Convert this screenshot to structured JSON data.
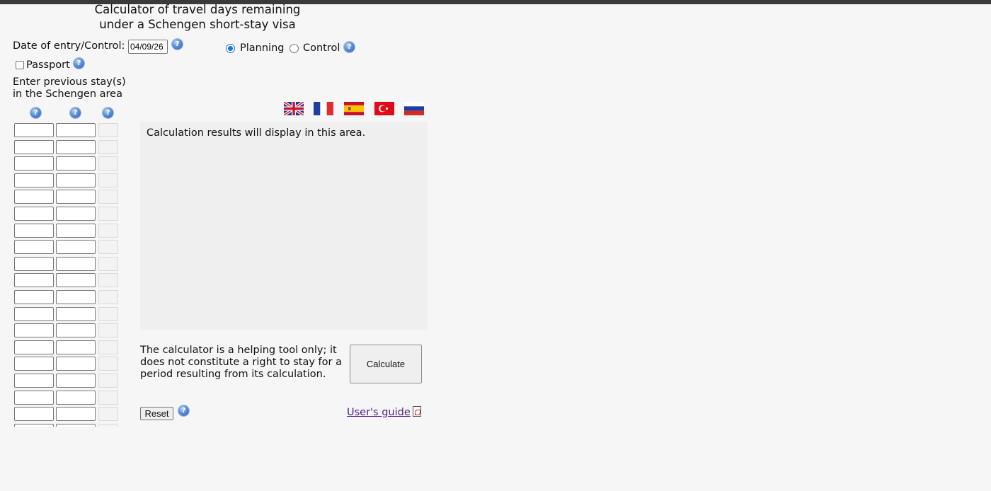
{
  "page": {
    "title_line1": "Calculator of travel days remaining",
    "title_line2": "under a Schengen short-stay visa",
    "help_symbol": "?"
  },
  "form": {
    "date_label": "Date of entry/Control:",
    "date_value": "04/09/26",
    "mode_planning": "Planning",
    "mode_control": "Control",
    "selected_mode": "Planning",
    "passport_label": "Passport",
    "passport_checked": false,
    "stays_line1": "Enter previous stay(s)",
    "stays_line2": "in the Schengen area",
    "stay_row_count": 19
  },
  "languages": [
    {
      "name": "uk-flag-icon"
    },
    {
      "name": "france-flag-icon"
    },
    {
      "name": "spain-flag-icon"
    },
    {
      "name": "turkey-flag-icon"
    },
    {
      "name": "russia-flag-icon"
    }
  ],
  "results": {
    "placeholder": "Calculation results will display in this area."
  },
  "footer": {
    "disclaimer": "The calculator is a helping tool only; it does not constitute a right to stay for a period resulting from its calculation.",
    "calculate_label": "Calculate",
    "reset_label": "Reset",
    "guide_label": "User's guide"
  },
  "colors": {
    "accent": "#1a73e8",
    "link": "#4b1c8a",
    "results_bg": "#efefef"
  }
}
